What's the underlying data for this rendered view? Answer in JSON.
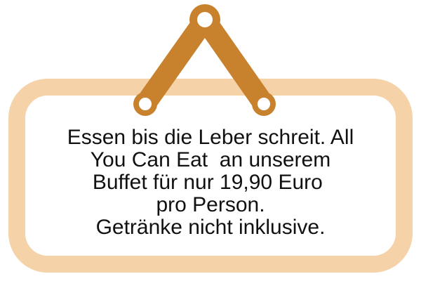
{
  "sign": {
    "lines": [
      "Essen bis die Leber schreit. All",
      "You Can Eat  an unserem",
      "Buffet für nur 19,90 Euro ",
      "pro Person.",
      "Getränke nicht inklusive."
    ]
  },
  "colors": {
    "board_border": "#f5d2a8",
    "board_fill": "#ffffff",
    "hanger": "#c8822e",
    "hanger_hole": "#ffffff"
  }
}
